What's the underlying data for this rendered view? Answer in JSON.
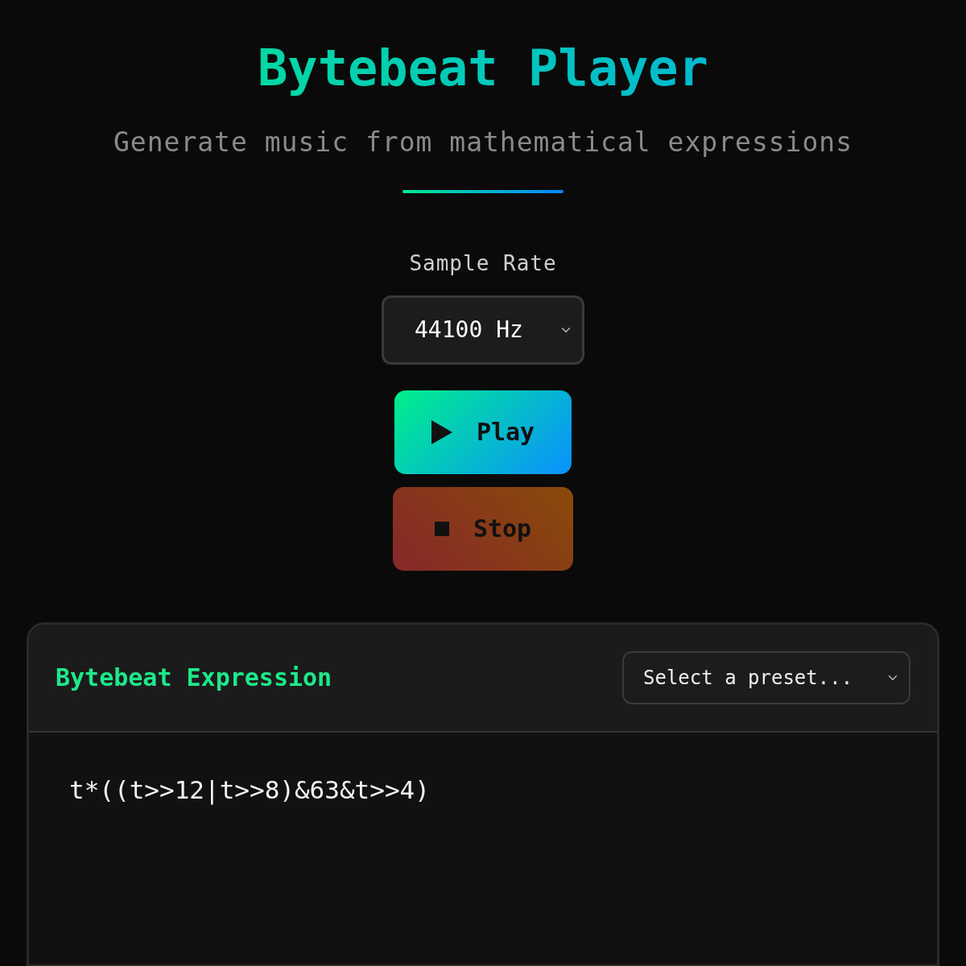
{
  "header": {
    "title": "Bytebeat Player",
    "subtitle": "Generate music from mathematical expressions"
  },
  "sample_rate": {
    "label": "Sample Rate",
    "value": "44100 Hz"
  },
  "buttons": [
    {
      "kind": "play",
      "label": "Play"
    },
    {
      "kind": "stop",
      "label": "Stop"
    }
  ],
  "editor": {
    "title": "Bytebeat Expression",
    "preset": "Select a preset...",
    "expression": "t*((t>>12|t>>8)&63&t>>4)"
  }
}
